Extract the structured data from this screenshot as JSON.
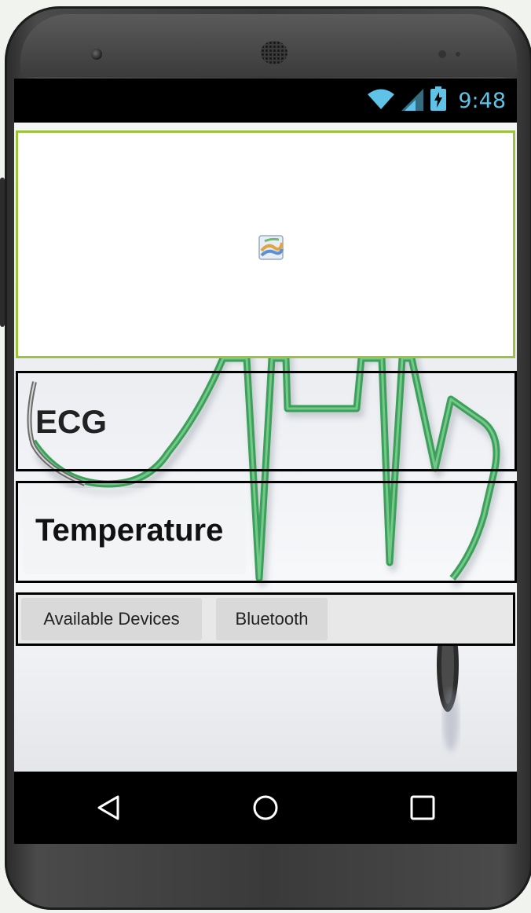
{
  "status_bar": {
    "time": "9:48",
    "icons": [
      "wifi-icon",
      "cell-signal-icon",
      "battery-charging-icon"
    ],
    "accent_color": "#5fc3e8"
  },
  "web_viewer": {
    "border_color": "#9cc33b",
    "image": "broken-image-icon"
  },
  "ecg": {
    "label": "ECG"
  },
  "temperature": {
    "label": "Temperature"
  },
  "buttons": {
    "available_devices": "Available Devices",
    "bluetooth": "Bluetooth"
  },
  "background": {
    "image": "stethoscope-ecg-heartbeat",
    "line_color": "#3da05a"
  },
  "nav_bar": {
    "icons": [
      "back-icon",
      "home-icon",
      "recents-icon"
    ]
  }
}
